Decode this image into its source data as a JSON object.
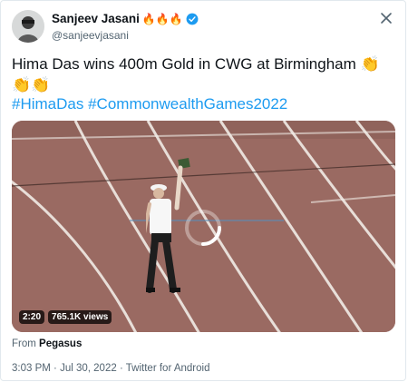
{
  "author": {
    "name": "Sanjeev Jasani",
    "handle": "@sanjeevjasani",
    "emojis": "🔥🔥🔥"
  },
  "tweet": {
    "text": "Hima Das wins 400m Gold in CWG at Birmingham",
    "claps": "👏👏👏",
    "hashtags": [
      "#HimaDas",
      "#CommonwealthGames2022"
    ]
  },
  "video": {
    "duration": "2:20",
    "views": "765.1K views"
  },
  "attribution": {
    "prefix": "From",
    "source": "Pegasus"
  },
  "meta": {
    "time": "3:03 PM",
    "separator": "·",
    "date": "Jul 30, 2022",
    "client": "Twitter for Android"
  },
  "colors": {
    "link": "#1d9bf0",
    "track": "#9a6a62",
    "verified": "#1d9bf0"
  }
}
